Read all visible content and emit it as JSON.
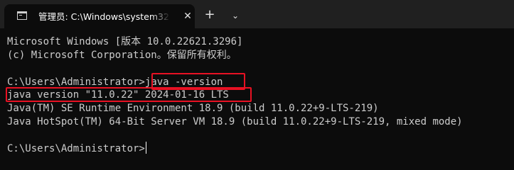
{
  "tab": {
    "icon": "terminal-icon",
    "title": "管理员: C:\\Windows\\system32",
    "close_icon": "close-icon",
    "close_glyph": "✕"
  },
  "toolbar": {
    "new_tab_icon": "plus-icon",
    "new_tab_glyph": "+",
    "dropdown_icon": "chevron-down-icon",
    "dropdown_glyph": "⌄"
  },
  "terminal": {
    "lines": [
      "Microsoft Windows [版本 10.0.22621.3296]",
      "(c) Microsoft Corporation。保留所有权利。",
      "",
      "C:\\Users\\Administrator>java -version",
      "java version \"11.0.22\" 2024-01-16 LTS",
      "Java(TM) SE Runtime Environment 18.9 (build 11.0.22+9-LTS-219)",
      "Java HotSpot(TM) 64-Bit Server VM 18.9 (build 11.0.22+9-LTS-219, mixed mode)",
      "",
      "C:\\Users\\Administrator>"
    ]
  },
  "colors": {
    "background": "#0c0c0c",
    "tabbar": "#202020",
    "text": "#cccccc",
    "highlight": "#e81123"
  }
}
